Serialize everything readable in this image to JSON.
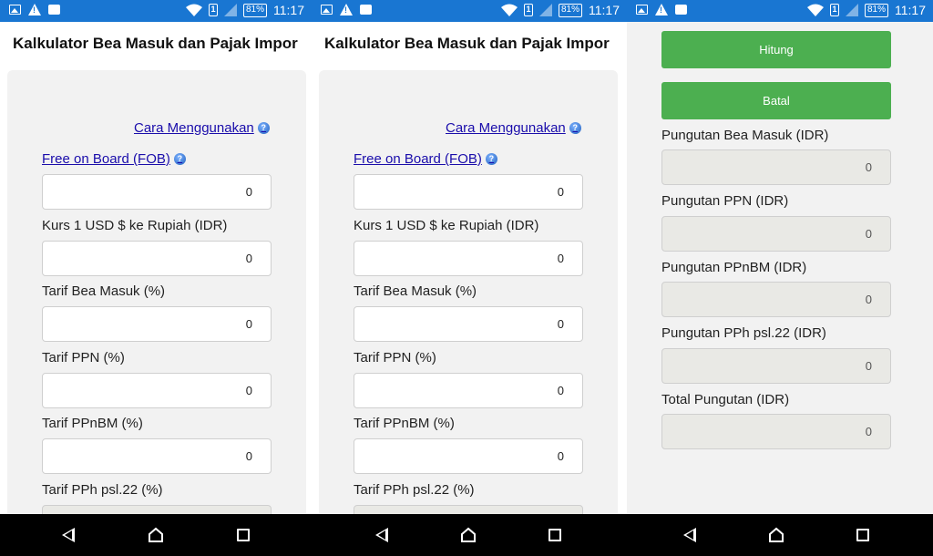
{
  "status": {
    "battery": "81%",
    "time": "11:17",
    "sim": "1"
  },
  "app": {
    "title": "Kalkulator Bea Masuk dan Pajak Impor"
  },
  "help": {
    "cara": "Cara Menggunakan",
    "fob": "Free on Board (FOB)",
    "q": "?"
  },
  "inputs": {
    "kurs_label": "Kurs 1 USD $ ke Rupiah (IDR)",
    "bea_label": "Tarif Bea Masuk (%)",
    "ppn_label": "Tarif PPN (%)",
    "ppnbm_label": "Tarif PPnBM (%)",
    "pph_label": "Tarif PPh psl.22 (%)",
    "fob_value": "0",
    "kurs_value": "0",
    "bea_value": "0",
    "ppn_value": "0",
    "ppnbm_value": "0"
  },
  "buttons": {
    "hitung": "Hitung",
    "batal": "Batal"
  },
  "results": {
    "bea_label": "Pungutan Bea Masuk (IDR)",
    "ppn_label": "Pungutan PPN (IDR)",
    "ppnbm_label": "Pungutan PPnBM (IDR)",
    "pph_label": "Pungutan PPh psl.22 (IDR)",
    "total_label": "Total Pungutan (IDR)",
    "bea_value": "0",
    "ppn_value": "0",
    "ppnbm_value": "0",
    "pph_value": "0",
    "total_value": "0"
  },
  "colors": {
    "statusbar": "#1976d2",
    "button": "#4caf50",
    "link": "#1a0dab",
    "card": "#f2f2f2"
  }
}
